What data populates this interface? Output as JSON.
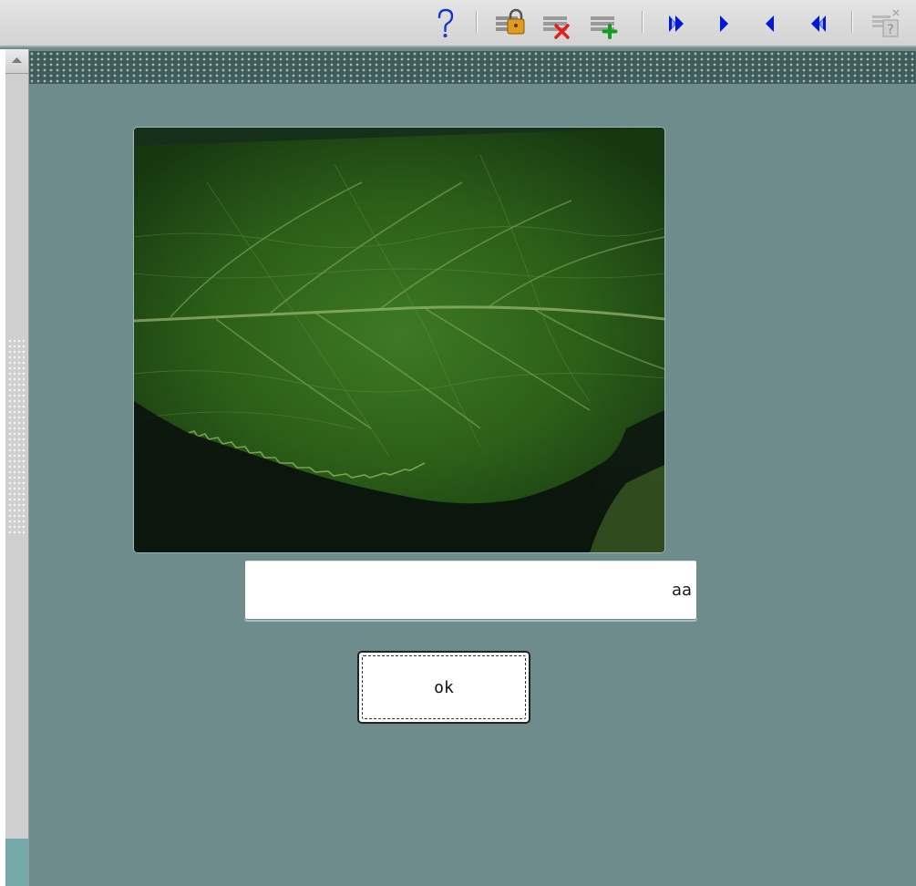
{
  "toolbar": {
    "buttons": [
      {
        "name": "help",
        "icon": "help-question-icon"
      },
      {
        "name": "lock",
        "icon": "lock-icon"
      },
      {
        "name": "delete-record",
        "icon": "delete-record-icon"
      },
      {
        "name": "add-record",
        "icon": "add-record-icon"
      },
      {
        "name": "last",
        "icon": "last-record-icon"
      },
      {
        "name": "next",
        "icon": "next-record-icon"
      },
      {
        "name": "previous",
        "icon": "previous-record-icon"
      },
      {
        "name": "first",
        "icon": "first-record-icon"
      },
      {
        "name": "record-help",
        "icon": "record-help-icon"
      }
    ]
  },
  "form": {
    "image_icon": "leaf-photo",
    "text_value": "aa",
    "ok_label": "ok"
  },
  "colors": {
    "background": "#6e8c8b",
    "toolbar": "#d8d8d8",
    "accent_blue": "#0018d8"
  }
}
